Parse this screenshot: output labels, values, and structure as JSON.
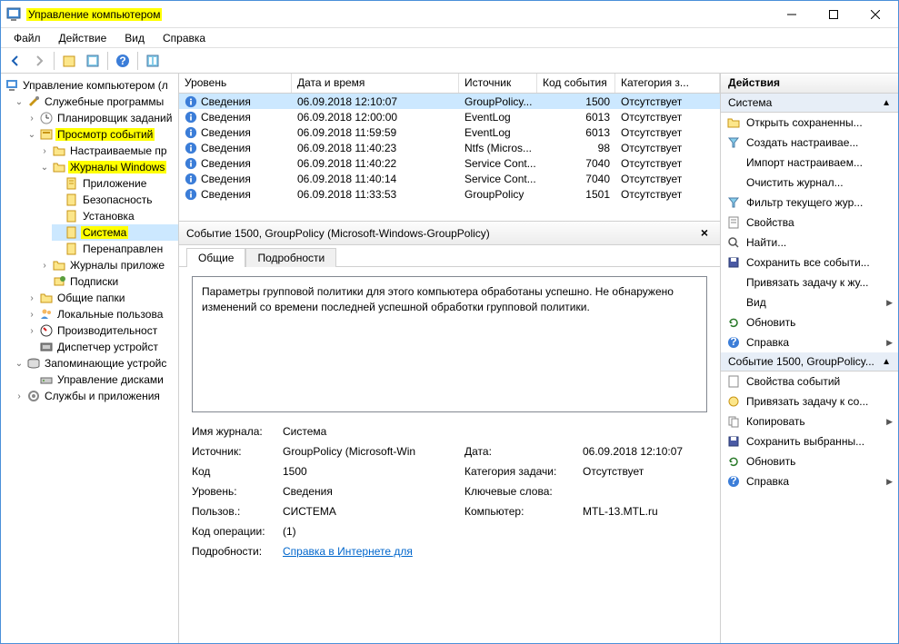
{
  "window": {
    "title": "Управление компьютером",
    "menus": [
      "Файл",
      "Действие",
      "Вид",
      "Справка"
    ]
  },
  "tree": {
    "root": "Управление компьютером (л",
    "service_programs": "Служебные программы",
    "task_scheduler": "Планировщик заданий",
    "event_viewer": "Просмотр событий",
    "custom_views": "Настраиваемые пр",
    "windows_logs": "Журналы Windows",
    "application": "Приложение",
    "security": "Безопасность",
    "setup": "Установка",
    "system": "Система",
    "forwarded": "Перенаправлен",
    "app_logs": "Журналы приложе",
    "subscriptions": "Подписки",
    "shared_folders": "Общие папки",
    "local_users": "Локальные пользова",
    "performance": "Производительност",
    "device_mgr": "Диспетчер устройст",
    "storage": "Запоминающие устройс",
    "disk_mgmt": "Управление дисками",
    "services_apps": "Службы и приложения"
  },
  "columns": {
    "level": "Уровень",
    "datetime": "Дата и время",
    "source": "Источник",
    "event_id": "Код события",
    "category": "Категория з..."
  },
  "events": [
    {
      "level": "Сведения",
      "date": "06.09.2018 12:10:07",
      "source": "GroupPolicy...",
      "id": "1500",
      "cat": "Отсутствует"
    },
    {
      "level": "Сведения",
      "date": "06.09.2018 12:00:00",
      "source": "EventLog",
      "id": "6013",
      "cat": "Отсутствует"
    },
    {
      "level": "Сведения",
      "date": "06.09.2018 11:59:59",
      "source": "EventLog",
      "id": "6013",
      "cat": "Отсутствует"
    },
    {
      "level": "Сведения",
      "date": "06.09.2018 11:40:23",
      "source": "Ntfs (Micros...",
      "id": "98",
      "cat": "Отсутствует"
    },
    {
      "level": "Сведения",
      "date": "06.09.2018 11:40:22",
      "source": "Service Cont...",
      "id": "7040",
      "cat": "Отсутствует"
    },
    {
      "level": "Сведения",
      "date": "06.09.2018 11:40:14",
      "source": "Service Cont...",
      "id": "7040",
      "cat": "Отсутствует"
    },
    {
      "level": "Сведения",
      "date": "06.09.2018 11:33:53",
      "source": "GroupPolicy",
      "id": "1501",
      "cat": "Отсутствует"
    }
  ],
  "detail": {
    "title": "Событие 1500, GroupPolicy (Microsoft-Windows-GroupPolicy)",
    "tab_general": "Общие",
    "tab_details": "Подробности",
    "message": "Параметры групповой политики для этого компьютера обработаны успешно. Не обнаружено изменений со времени последней успешной обработки групповой политики.",
    "log_name_label": "Имя журнала:",
    "log_name": "Система",
    "source_label": "Источник:",
    "source": "GroupPolicy (Microsoft-Win",
    "date_label": "Дата:",
    "date": "06.09.2018 12:10:07",
    "id_label": "Код",
    "id": "1500",
    "category_label": "Категория задачи:",
    "category": "Отсутствует",
    "level_label": "Уровень:",
    "level": "Сведения",
    "keywords_label": "Ключевые слова:",
    "keywords": "",
    "user_label": "Пользов.:",
    "user": "СИСТЕМА",
    "computer_label": "Компьютер:",
    "computer": "MTL-13.MTL.ru",
    "opcode_label": "Код операции:",
    "opcode": "(1)",
    "more_label": "Подробности:",
    "more_link": "Справка в Интернете для"
  },
  "actions": {
    "header": "Действия",
    "group1": "Система",
    "open_saved": "Открыть сохраненны...",
    "create_custom": "Создать настраивае...",
    "import_custom": "Импорт настраиваем...",
    "clear_log": "Очистить журнал...",
    "filter": "Фильтр текущего жур...",
    "properties": "Свойства",
    "find": "Найти...",
    "save_all": "Сохранить все событи...",
    "attach_task": "Привязать задачу к жу...",
    "view": "Вид",
    "refresh": "Обновить",
    "help": "Справка",
    "group2": "Событие 1500, GroupPolicy...",
    "event_props": "Свойства событий",
    "attach_task2": "Привязать задачу к со...",
    "copy": "Копировать",
    "save_selected": "Сохранить выбранны...",
    "refresh2": "Обновить",
    "help2": "Справка"
  }
}
